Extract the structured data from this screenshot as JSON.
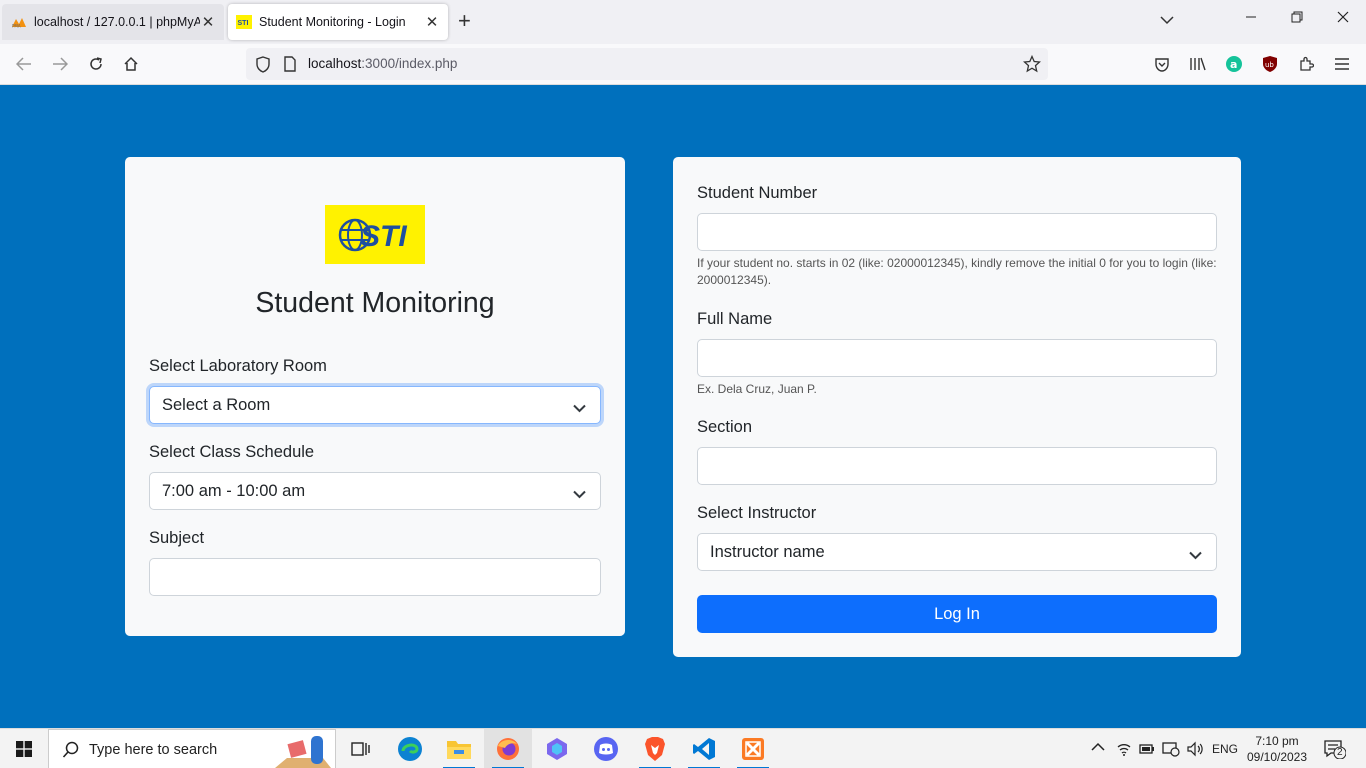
{
  "browser": {
    "tabs": [
      {
        "title": "localhost / 127.0.0.1 | phpMyAdmin",
        "favicon": "phpmyadmin-icon",
        "active": false
      },
      {
        "title": "Student Monitoring - Login",
        "favicon": "sti-icon",
        "active": true
      }
    ],
    "url_host": "localhost",
    "url_rest": ":3000/index.php"
  },
  "left_card": {
    "logo_text": "STI",
    "title": "Student Monitoring",
    "room_label": "Select Laboratory Room",
    "room_value": "Select a Room",
    "schedule_label": "Select Class Schedule",
    "schedule_value": "7:00 am - 10:00 am",
    "subject_label": "Subject",
    "subject_value": ""
  },
  "right_card": {
    "student_number_label": "Student Number",
    "student_number_value": "",
    "student_number_help": "If your student no. starts in 02 (like: 02000012345), kindly remove the initial 0 for you to login (like: 2000012345).",
    "full_name_label": "Full Name",
    "full_name_value": "",
    "full_name_help": "Ex. Dela Cruz, Juan P.",
    "section_label": "Section",
    "section_value": "",
    "instructor_label": "Select Instructor",
    "instructor_value": "Instructor name",
    "login_label": "Log In"
  },
  "taskbar": {
    "search_placeholder": "Type here to search",
    "language": "ENG",
    "time": "7:10 pm",
    "date": "09/10/2023",
    "notification_count": "2"
  },
  "colors": {
    "page_background": "#0070bd",
    "primary_button": "#0d6efd",
    "logo_background": "#fff200"
  }
}
